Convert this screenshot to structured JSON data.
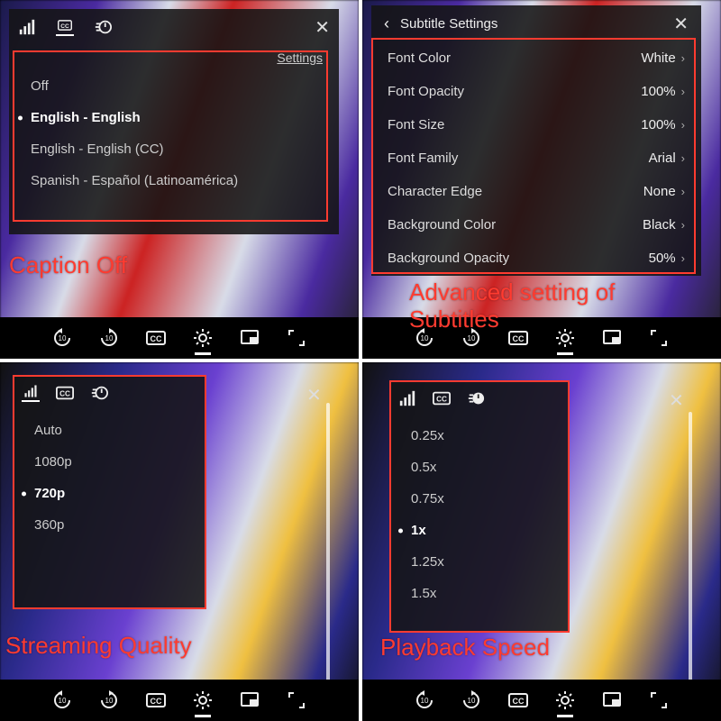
{
  "q1": {
    "annotation": "Caption Off",
    "settings_link": "Settings",
    "options": [
      {
        "label": "Off",
        "selected": false
      },
      {
        "label": "English - English",
        "selected": true
      },
      {
        "label": "English - English (CC)",
        "selected": false
      },
      {
        "label": "Spanish - Español (Latinoamérica)",
        "selected": false
      }
    ]
  },
  "q2": {
    "annotation": "Advanced setting of\nSubtitles",
    "header": "Subtitle Settings",
    "rows": [
      {
        "k": "Font Color",
        "v": "White"
      },
      {
        "k": "Font Opacity",
        "v": "100%"
      },
      {
        "k": "Font Size",
        "v": "100%"
      },
      {
        "k": "Font Family",
        "v": "Arial"
      },
      {
        "k": "Character Edge",
        "v": "None"
      },
      {
        "k": "Background Color",
        "v": "Black"
      },
      {
        "k": "Background Opacity",
        "v": "50%"
      }
    ]
  },
  "q3": {
    "annotation": "Streaming Quality",
    "options": [
      {
        "label": "Auto",
        "selected": false
      },
      {
        "label": "1080p",
        "selected": false
      },
      {
        "label": "720p",
        "selected": true
      },
      {
        "label": "360p",
        "selected": false
      }
    ]
  },
  "q4": {
    "annotation": "Playback Speed",
    "options": [
      {
        "label": "0.25x",
        "selected": false
      },
      {
        "label": "0.5x",
        "selected": false
      },
      {
        "label": "0.75x",
        "selected": false
      },
      {
        "label": "1x",
        "selected": true
      },
      {
        "label": "1.25x",
        "selected": false
      },
      {
        "label": "1.5x",
        "selected": false
      }
    ]
  }
}
